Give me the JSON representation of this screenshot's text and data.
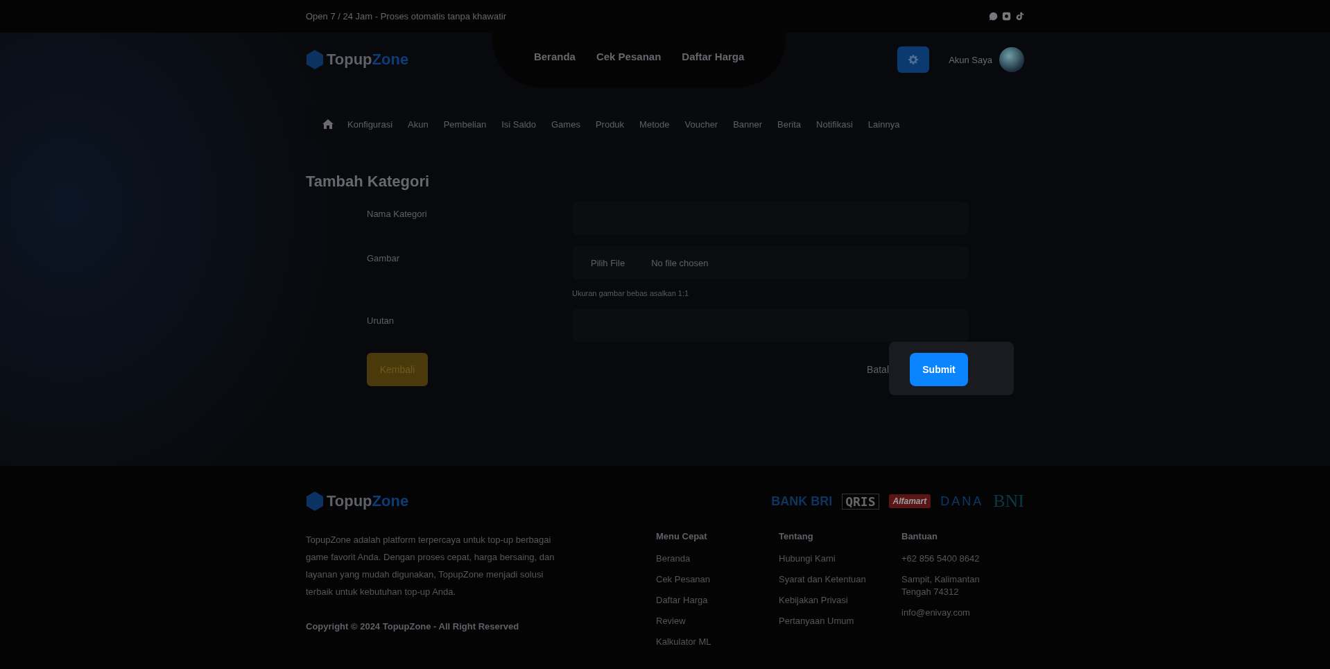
{
  "top_bar": {
    "text": "Open 7 / 24 Jam - Proses otomatis tanpa khawatir"
  },
  "header": {
    "brand_first": "Topup",
    "brand_second": "Zone",
    "nav": [
      "Beranda",
      "Cek Pesanan",
      "Daftar Harga"
    ],
    "account": "Akun Saya"
  },
  "admin_menu": [
    "Konfigurasi",
    "Akun",
    "Pembelian",
    "Isi Saldo",
    "Games",
    "Produk",
    "Metode",
    "Voucher",
    "Banner",
    "Berita",
    "Notifikasi",
    "Lainnya"
  ],
  "page_title": "Tambah Kategori",
  "form": {
    "fields": [
      {
        "kind": "text",
        "label": "Nama Kategori"
      },
      {
        "kind": "file",
        "label": "Gambar",
        "button": "Pilih File",
        "value": "No file chosen",
        "hint": "Ukuran gambar bebas asalkan 1:1"
      },
      {
        "kind": "text",
        "label": "Urutan"
      }
    ],
    "back": "Kembali",
    "cancel": "Batal",
    "submit": "Submit"
  },
  "footer": {
    "brand_first": "Topup",
    "brand_second": "Zone",
    "payment_logos": [
      "BANK BRI",
      "QRIS",
      "Alfamart",
      "DANA",
      "BNI"
    ],
    "description": "TopupZone adalah platform terpercaya untuk top-up berbagai game favorit Anda. Dengan proses cepat, harga bersaing, dan layanan yang mudah digunakan, TopupZone menjadi solusi terbaik untuk kebutuhan top-up Anda.",
    "copyright": "Copyright © 2024 TopupZone - All Right Reserved",
    "columns": [
      {
        "title": "Menu Cepat",
        "links": [
          "Beranda",
          "Cek Pesanan",
          "Daftar Harga",
          "Review",
          "Kalkulator ML"
        ]
      },
      {
        "title": "Tentang",
        "links": [
          "Hubungi Kami",
          "Syarat dan Ketentuan",
          "Kebijakan Privasi",
          "Pertanyaan Umum"
        ]
      },
      {
        "title": "Bantuan",
        "links": [
          "+62 856 5400 8642",
          "Sampit, Kalimantan Tengah 74312",
          "info@enivay.com"
        ]
      }
    ]
  }
}
